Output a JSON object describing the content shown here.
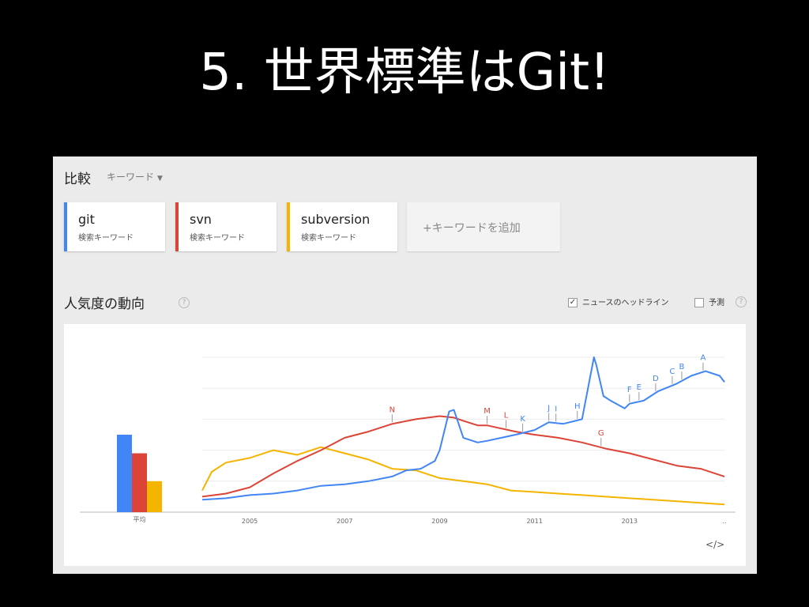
{
  "slide": {
    "title": "5. 世界標準はGit!"
  },
  "compare": {
    "label": "比較",
    "dropdown": "キーワード"
  },
  "keywords": [
    {
      "term": "git",
      "sub": "検索キーワード",
      "color": "#4285f4"
    },
    {
      "term": "svn",
      "sub": "検索キーワード",
      "color": "#db4437"
    },
    {
      "term": "subversion",
      "sub": "検索キーワード",
      "color": "#f4b400"
    }
  ],
  "add_keyword": "+キーワードを追加",
  "section": {
    "title": "人気度の動向",
    "help": "?",
    "news_headlines": "ニュースのヘッドライン",
    "forecast": "予測"
  },
  "embed": "</>",
  "chart_data": [
    {
      "type": "bar",
      "categories": [
        "平均"
      ],
      "series": [
        {
          "name": "git",
          "values": [
            50
          ],
          "color": "#4285f4"
        },
        {
          "name": "svn",
          "values": [
            38
          ],
          "color": "#db4437"
        },
        {
          "name": "subversion",
          "values": [
            20
          ],
          "color": "#f4b400"
        }
      ],
      "ylim": [
        0,
        100
      ]
    },
    {
      "type": "line",
      "x_ticks": [
        "2005",
        "2007",
        "2009",
        "2011",
        "2013",
        ".."
      ],
      "xlim": [
        2004.0,
        2015.0
      ],
      "ylim": [
        0,
        100
      ],
      "grid": true,
      "series": [
        {
          "name": "git",
          "color": "#4285f4",
          "x": [
            2004.0,
            2004.5,
            2005.0,
            2005.5,
            2006.0,
            2006.5,
            2007.0,
            2007.5,
            2008.0,
            2008.3,
            2008.6,
            2008.9,
            2009.0,
            2009.2,
            2009.3,
            2009.5,
            2009.8,
            2010.0,
            2010.3,
            2010.6,
            2011.0,
            2011.3,
            2011.6,
            2012.0,
            2012.25,
            2012.3,
            2012.45,
            2012.6,
            2012.9,
            2013.0,
            2013.3,
            2013.6,
            2014.0,
            2014.3,
            2014.6,
            2014.9,
            2015.0
          ],
          "y": [
            8,
            9,
            11,
            12,
            14,
            17,
            18,
            20,
            23,
            27,
            28,
            33,
            40,
            65,
            66,
            48,
            45,
            46,
            48,
            50,
            53,
            58,
            57,
            60,
            100,
            95,
            75,
            72,
            67,
            70,
            72,
            78,
            83,
            88,
            91,
            88,
            84
          ]
        },
        {
          "name": "svn",
          "color": "#db4437",
          "x": [
            2004.0,
            2004.5,
            2005.0,
            2005.5,
            2006.0,
            2006.5,
            2007.0,
            2007.5,
            2008.0,
            2008.5,
            2009.0,
            2009.3,
            2009.5,
            2009.8,
            2010.0,
            2010.3,
            2010.6,
            2011.0,
            2011.5,
            2012.0,
            2012.5,
            2013.0,
            2013.5,
            2014.0,
            2014.5,
            2015.0
          ],
          "y": [
            10,
            12,
            16,
            25,
            33,
            40,
            48,
            52,
            57,
            60,
            62,
            61,
            59,
            56,
            56,
            54,
            52,
            50,
            48,
            45,
            41,
            38,
            34,
            30,
            28,
            23
          ]
        },
        {
          "name": "subversion",
          "color": "#f4b400",
          "x": [
            2004.0,
            2004.2,
            2004.5,
            2005.0,
            2005.5,
            2006.0,
            2006.5,
            2007.0,
            2007.5,
            2008.0,
            2008.5,
            2009.0,
            2009.5,
            2010.0,
            2010.5,
            2011.0,
            2011.5,
            2012.0,
            2012.5,
            2013.0,
            2013.5,
            2014.0,
            2014.5,
            2015.0
          ],
          "y": [
            14,
            26,
            32,
            35,
            40,
            37,
            42,
            38,
            34,
            28,
            27,
            22,
            20,
            18,
            14,
            13,
            12,
            11,
            10,
            9,
            8,
            7,
            6,
            5
          ]
        }
      ],
      "annotations": [
        {
          "label": "N",
          "x": 2008.0,
          "series": "svn"
        },
        {
          "label": "M",
          "x": 2010.0,
          "series": "svn"
        },
        {
          "label": "L",
          "x": 2010.4,
          "series": "svn"
        },
        {
          "label": "K",
          "x": 2010.75,
          "series": "git"
        },
        {
          "label": "J",
          "x": 2011.3,
          "series": "git"
        },
        {
          "label": "I",
          "x": 2011.45,
          "series": "git"
        },
        {
          "label": "H",
          "x": 2011.9,
          "series": "git"
        },
        {
          "label": "G",
          "x": 2012.4,
          "series": "svn"
        },
        {
          "label": "F",
          "x": 2013.0,
          "series": "git"
        },
        {
          "label": "E",
          "x": 2013.2,
          "series": "git"
        },
        {
          "label": "D",
          "x": 2013.55,
          "series": "git"
        },
        {
          "label": "C",
          "x": 2013.9,
          "series": "git"
        },
        {
          "label": "B",
          "x": 2014.1,
          "series": "git"
        },
        {
          "label": "A",
          "x": 2014.55,
          "series": "git"
        }
      ]
    }
  ]
}
